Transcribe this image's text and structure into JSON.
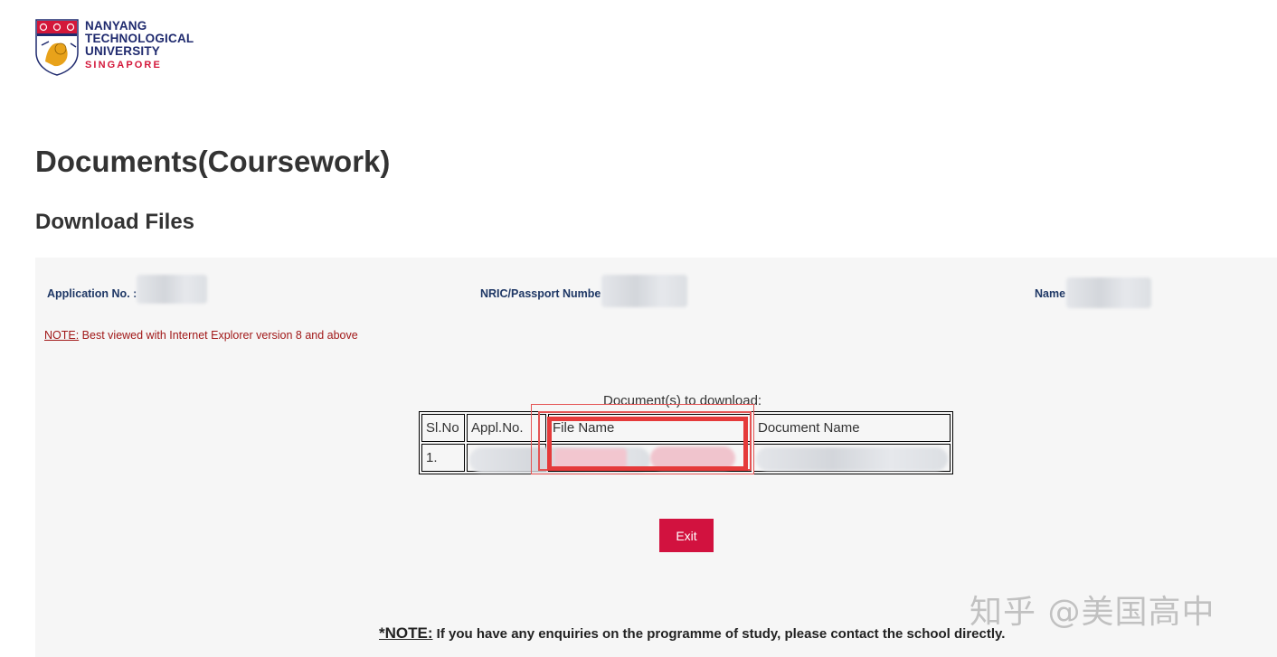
{
  "logo": {
    "line1": "NANYANG",
    "line2": "TECHNOLOGICAL",
    "line3": "UNIVERSITY",
    "line4": "SINGAPORE"
  },
  "page": {
    "title": "Documents(Coursework)",
    "subtitle": "Download Files"
  },
  "info": {
    "application_label": "Application No. :",
    "nric_label": "NRIC/Passport Numbe",
    "name_label": "Name"
  },
  "note": {
    "key": "NOTE:",
    "text": " Best viewed with Internet Explorer version 8 and above"
  },
  "table": {
    "caption": "Document(s) to download:",
    "headers": [
      "Sl.No",
      "Appl.No.",
      "File Name",
      "Document Name"
    ],
    "rows": [
      {
        "slno": "1."
      }
    ]
  },
  "buttons": {
    "exit_label": "Exit"
  },
  "footer": {
    "key": "*NOTE:",
    "text": " If you have any enquiries on the programme of study, please contact the school directly."
  },
  "watermark": "知乎 @美国高中",
  "colors": {
    "brand_navy": "#1f2a6e",
    "brand_red": "#d3173a",
    "exit_button": "#d2123f",
    "note_red": "#a11818",
    "highlight_red": "#e53a3a"
  }
}
